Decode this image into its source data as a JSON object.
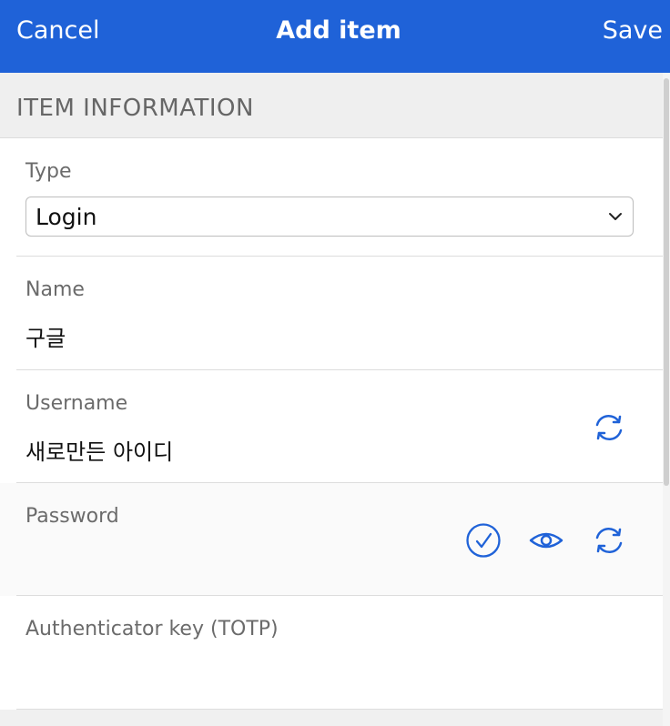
{
  "header": {
    "cancel": "Cancel",
    "title": "Add item",
    "save": "Save"
  },
  "section": {
    "title": "ITEM INFORMATION"
  },
  "type_field": {
    "label": "Type",
    "value": "Login"
  },
  "name_field": {
    "label": "Name",
    "value": "구글"
  },
  "username_field": {
    "label": "Username",
    "value": "새로만든 아이디"
  },
  "password_field": {
    "label": "Password",
    "value": ""
  },
  "totp_field": {
    "label": "Authenticator key (TOTP)",
    "value": ""
  },
  "colors": {
    "accent": "#1f62d8",
    "header_bg": "#1f62d8",
    "section_bg": "#efefef",
    "label": "#6b6b6b"
  },
  "icons": [
    "chevron-down-icon",
    "refresh-icon",
    "check-circle-icon",
    "eye-icon"
  ]
}
